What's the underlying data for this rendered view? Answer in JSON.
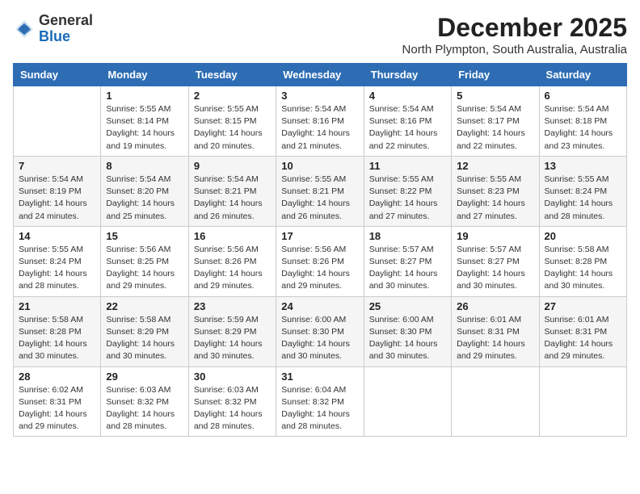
{
  "header": {
    "logo_general": "General",
    "logo_blue": "Blue",
    "month_year": "December 2025",
    "location": "North Plympton, South Australia, Australia"
  },
  "days_of_week": [
    "Sunday",
    "Monday",
    "Tuesday",
    "Wednesday",
    "Thursday",
    "Friday",
    "Saturday"
  ],
  "weeks": [
    [
      {
        "day": "",
        "info": ""
      },
      {
        "day": "1",
        "info": "Sunrise: 5:55 AM\nSunset: 8:14 PM\nDaylight: 14 hours\nand 19 minutes."
      },
      {
        "day": "2",
        "info": "Sunrise: 5:55 AM\nSunset: 8:15 PM\nDaylight: 14 hours\nand 20 minutes."
      },
      {
        "day": "3",
        "info": "Sunrise: 5:54 AM\nSunset: 8:16 PM\nDaylight: 14 hours\nand 21 minutes."
      },
      {
        "day": "4",
        "info": "Sunrise: 5:54 AM\nSunset: 8:16 PM\nDaylight: 14 hours\nand 22 minutes."
      },
      {
        "day": "5",
        "info": "Sunrise: 5:54 AM\nSunset: 8:17 PM\nDaylight: 14 hours\nand 22 minutes."
      },
      {
        "day": "6",
        "info": "Sunrise: 5:54 AM\nSunset: 8:18 PM\nDaylight: 14 hours\nand 23 minutes."
      }
    ],
    [
      {
        "day": "7",
        "info": "Sunrise: 5:54 AM\nSunset: 8:19 PM\nDaylight: 14 hours\nand 24 minutes."
      },
      {
        "day": "8",
        "info": "Sunrise: 5:54 AM\nSunset: 8:20 PM\nDaylight: 14 hours\nand 25 minutes."
      },
      {
        "day": "9",
        "info": "Sunrise: 5:54 AM\nSunset: 8:21 PM\nDaylight: 14 hours\nand 26 minutes."
      },
      {
        "day": "10",
        "info": "Sunrise: 5:55 AM\nSunset: 8:21 PM\nDaylight: 14 hours\nand 26 minutes."
      },
      {
        "day": "11",
        "info": "Sunrise: 5:55 AM\nSunset: 8:22 PM\nDaylight: 14 hours\nand 27 minutes."
      },
      {
        "day": "12",
        "info": "Sunrise: 5:55 AM\nSunset: 8:23 PM\nDaylight: 14 hours\nand 27 minutes."
      },
      {
        "day": "13",
        "info": "Sunrise: 5:55 AM\nSunset: 8:24 PM\nDaylight: 14 hours\nand 28 minutes."
      }
    ],
    [
      {
        "day": "14",
        "info": "Sunrise: 5:55 AM\nSunset: 8:24 PM\nDaylight: 14 hours\nand 28 minutes."
      },
      {
        "day": "15",
        "info": "Sunrise: 5:56 AM\nSunset: 8:25 PM\nDaylight: 14 hours\nand 29 minutes."
      },
      {
        "day": "16",
        "info": "Sunrise: 5:56 AM\nSunset: 8:26 PM\nDaylight: 14 hours\nand 29 minutes."
      },
      {
        "day": "17",
        "info": "Sunrise: 5:56 AM\nSunset: 8:26 PM\nDaylight: 14 hours\nand 29 minutes."
      },
      {
        "day": "18",
        "info": "Sunrise: 5:57 AM\nSunset: 8:27 PM\nDaylight: 14 hours\nand 30 minutes."
      },
      {
        "day": "19",
        "info": "Sunrise: 5:57 AM\nSunset: 8:27 PM\nDaylight: 14 hours\nand 30 minutes."
      },
      {
        "day": "20",
        "info": "Sunrise: 5:58 AM\nSunset: 8:28 PM\nDaylight: 14 hours\nand 30 minutes."
      }
    ],
    [
      {
        "day": "21",
        "info": "Sunrise: 5:58 AM\nSunset: 8:28 PM\nDaylight: 14 hours\nand 30 minutes."
      },
      {
        "day": "22",
        "info": "Sunrise: 5:58 AM\nSunset: 8:29 PM\nDaylight: 14 hours\nand 30 minutes."
      },
      {
        "day": "23",
        "info": "Sunrise: 5:59 AM\nSunset: 8:29 PM\nDaylight: 14 hours\nand 30 minutes."
      },
      {
        "day": "24",
        "info": "Sunrise: 6:00 AM\nSunset: 8:30 PM\nDaylight: 14 hours\nand 30 minutes."
      },
      {
        "day": "25",
        "info": "Sunrise: 6:00 AM\nSunset: 8:30 PM\nDaylight: 14 hours\nand 30 minutes."
      },
      {
        "day": "26",
        "info": "Sunrise: 6:01 AM\nSunset: 8:31 PM\nDaylight: 14 hours\nand 29 minutes."
      },
      {
        "day": "27",
        "info": "Sunrise: 6:01 AM\nSunset: 8:31 PM\nDaylight: 14 hours\nand 29 minutes."
      }
    ],
    [
      {
        "day": "28",
        "info": "Sunrise: 6:02 AM\nSunset: 8:31 PM\nDaylight: 14 hours\nand 29 minutes."
      },
      {
        "day": "29",
        "info": "Sunrise: 6:03 AM\nSunset: 8:32 PM\nDaylight: 14 hours\nand 28 minutes."
      },
      {
        "day": "30",
        "info": "Sunrise: 6:03 AM\nSunset: 8:32 PM\nDaylight: 14 hours\nand 28 minutes."
      },
      {
        "day": "31",
        "info": "Sunrise: 6:04 AM\nSunset: 8:32 PM\nDaylight: 14 hours\nand 28 minutes."
      },
      {
        "day": "",
        "info": ""
      },
      {
        "day": "",
        "info": ""
      },
      {
        "day": "",
        "info": ""
      }
    ]
  ]
}
